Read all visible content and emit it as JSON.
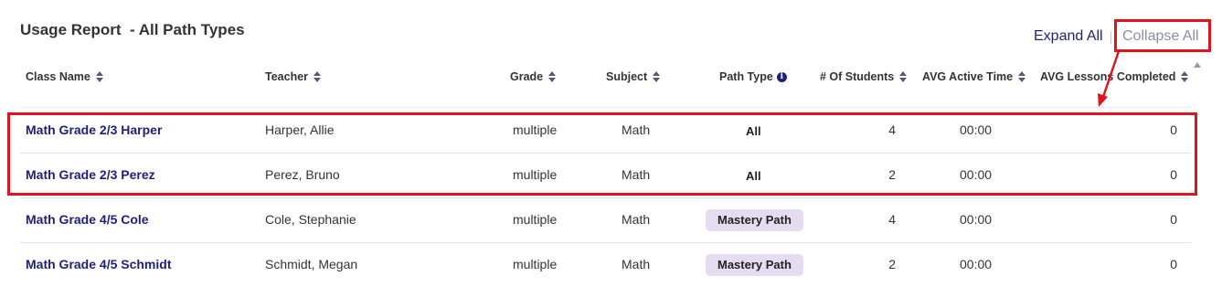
{
  "report": {
    "title": "Usage Report  - All Path Types",
    "expand_all": "Expand All",
    "collapse_all": "Collapse All"
  },
  "columns": [
    {
      "label": "Class Name",
      "sortable": true
    },
    {
      "label": "Teacher",
      "sortable": true
    },
    {
      "label": "Grade",
      "sortable": true
    },
    {
      "label": "Subject",
      "sortable": true
    },
    {
      "label": "Path Type",
      "sortable": false,
      "info_icon": "i"
    },
    {
      "label": "# Of Students",
      "sortable": true
    },
    {
      "label": "AVG Active Time",
      "sortable": true
    },
    {
      "label": "AVG Lessons Completed",
      "sortable": true
    }
  ],
  "rows": [
    {
      "class_name": "Math Grade 2/3 Harper",
      "teacher": "Harper, Allie",
      "grade": "multiple",
      "subject": "Math",
      "path_type": "All",
      "students": "4",
      "avg_active_time": "00:00",
      "avg_lessons_completed": "0"
    },
    {
      "class_name": "Math Grade 2/3 Perez",
      "teacher": "Perez, Bruno",
      "grade": "multiple",
      "subject": "Math",
      "path_type": "All",
      "students": "2",
      "avg_active_time": "00:00",
      "avg_lessons_completed": "0"
    },
    {
      "class_name": "Math Grade 4/5 Cole",
      "teacher": "Cole, Stephanie",
      "grade": "multiple",
      "subject": "Math",
      "path_type": "Mastery Path",
      "students": "4",
      "avg_active_time": "00:00",
      "avg_lessons_completed": "0"
    },
    {
      "class_name": "Math Grade 4/5 Schmidt",
      "teacher": "Schmidt, Megan",
      "grade": "multiple",
      "subject": "Math",
      "path_type": "Mastery Path",
      "students": "2",
      "avg_active_time": "00:00",
      "avg_lessons_completed": "0"
    }
  ],
  "colors": {
    "link": "#1f1f7a",
    "annotation": "#e0141e",
    "badge_bg": "#e6dcf2",
    "muted_link": "#8a8fa8"
  },
  "icons": {
    "sort": "sort-arrows-icon",
    "info": "info-icon",
    "scroll_up": "scroll-up-arrow-icon"
  }
}
